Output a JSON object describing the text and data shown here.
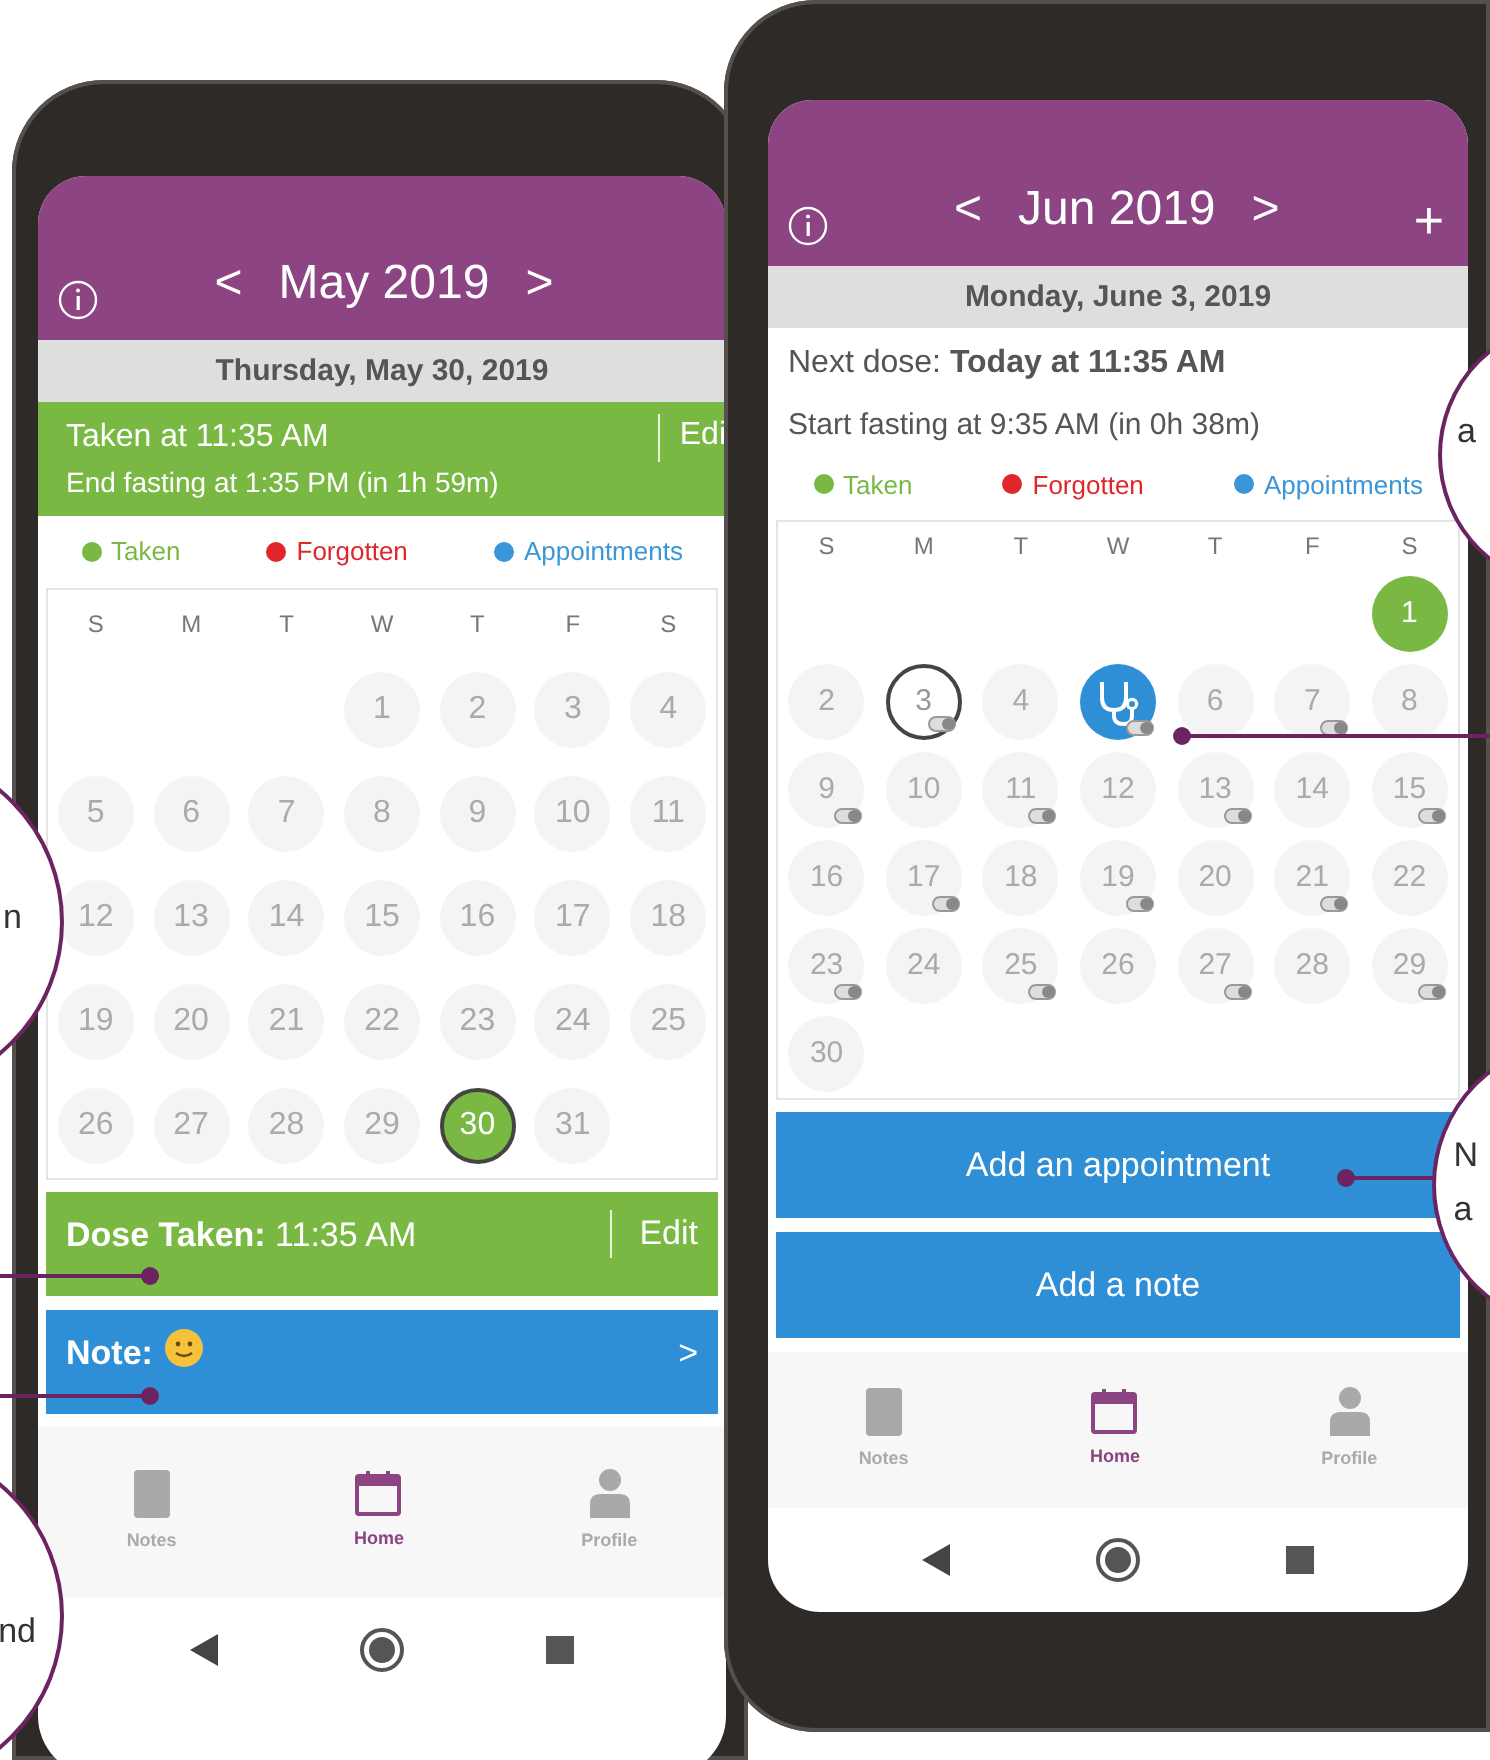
{
  "phones": [
    {
      "header": {
        "prev": "<",
        "title": "May 2019",
        "next": ">"
      },
      "date": "Thursday, May 30, 2019",
      "status": {
        "kind": "taken",
        "line1": "Taken at 11:35 AM",
        "edit": "Edi",
        "line2": "End fasting at 1:35 PM (in 1h 59m)"
      },
      "legend": [
        {
          "label": "Taken",
          "color": "#78b843"
        },
        {
          "label": "Forgotten",
          "color": "#e0262b"
        },
        {
          "label": "Appointments",
          "color": "#3a96d6"
        }
      ],
      "weekdays": [
        "S",
        "M",
        "T",
        "W",
        "T",
        "F",
        "S"
      ],
      "weeks": [
        [
          {
            "kind": "blank"
          },
          {
            "kind": "blank"
          },
          {
            "kind": "blank"
          },
          {
            "kind": "day",
            "day": "1",
            "taken": false,
            "selected": false,
            "pill": false
          },
          {
            "kind": "day",
            "day": "2",
            "taken": false,
            "selected": false,
            "pill": false
          },
          {
            "kind": "day",
            "day": "3",
            "taken": false,
            "selected": false,
            "pill": false
          },
          {
            "kind": "day",
            "day": "4",
            "taken": false,
            "selected": false,
            "pill": false
          }
        ],
        [
          {
            "kind": "day",
            "day": "5",
            "taken": false,
            "selected": false,
            "pill": false
          },
          {
            "kind": "day",
            "day": "6",
            "taken": false,
            "selected": false,
            "pill": false
          },
          {
            "kind": "day",
            "day": "7",
            "taken": false,
            "selected": false,
            "pill": false
          },
          {
            "kind": "day",
            "day": "8",
            "taken": false,
            "selected": false,
            "pill": false
          },
          {
            "kind": "day",
            "day": "9",
            "taken": false,
            "selected": false,
            "pill": false
          },
          {
            "kind": "day",
            "day": "10",
            "taken": false,
            "selected": false,
            "pill": false
          },
          {
            "kind": "day",
            "day": "11",
            "taken": false,
            "selected": false,
            "pill": false
          }
        ],
        [
          {
            "kind": "day",
            "day": "12",
            "taken": false,
            "selected": false,
            "pill": false
          },
          {
            "kind": "day",
            "day": "13",
            "taken": false,
            "selected": false,
            "pill": false
          },
          {
            "kind": "day",
            "day": "14",
            "taken": false,
            "selected": false,
            "pill": false
          },
          {
            "kind": "day",
            "day": "15",
            "taken": false,
            "selected": false,
            "pill": false
          },
          {
            "kind": "day",
            "day": "16",
            "taken": false,
            "selected": false,
            "pill": false
          },
          {
            "kind": "day",
            "day": "17",
            "taken": false,
            "selected": false,
            "pill": false
          },
          {
            "kind": "day",
            "day": "18",
            "taken": false,
            "selected": false,
            "pill": false
          }
        ],
        [
          {
            "kind": "day",
            "day": "19",
            "taken": false,
            "selected": false,
            "pill": false
          },
          {
            "kind": "day",
            "day": "20",
            "taken": false,
            "selected": false,
            "pill": false
          },
          {
            "kind": "day",
            "day": "21",
            "taken": false,
            "selected": false,
            "pill": false
          },
          {
            "kind": "day",
            "day": "22",
            "taken": false,
            "selected": false,
            "pill": false
          },
          {
            "kind": "day",
            "day": "23",
            "taken": false,
            "selected": false,
            "pill": false
          },
          {
            "kind": "day",
            "day": "24",
            "taken": false,
            "selected": false,
            "pill": false
          },
          {
            "kind": "day",
            "day": "25",
            "taken": false,
            "selected": false,
            "pill": false
          }
        ],
        [
          {
            "kind": "day",
            "day": "26",
            "taken": false,
            "selected": false,
            "pill": false
          },
          {
            "kind": "day",
            "day": "27",
            "taken": false,
            "selected": false,
            "pill": false
          },
          {
            "kind": "day",
            "day": "28",
            "taken": false,
            "selected": false,
            "pill": false
          },
          {
            "kind": "day",
            "day": "29",
            "taken": false,
            "selected": false,
            "pill": false
          },
          {
            "kind": "day",
            "day": "30",
            "taken": true,
            "selected": true,
            "pill": false
          },
          {
            "kind": "day",
            "day": "31",
            "taken": false,
            "selected": false,
            "pill": false
          },
          {
            "kind": "blank"
          }
        ]
      ],
      "actions": [
        {
          "kind": "dose",
          "label": "Dose Taken:",
          "text": "11:35 AM",
          "edit": "Edit"
        },
        {
          "kind": "note",
          "label": "Note:",
          "arrow": ">"
        }
      ],
      "tabs": [
        {
          "kind": "notes",
          "label": "Notes",
          "selected": false
        },
        {
          "kind": "home",
          "label": "Home",
          "selected": true
        },
        {
          "kind": "profile",
          "label": "Profile",
          "selected": false
        }
      ]
    },
    {
      "header": {
        "prev": "<",
        "title": "Jun 2019",
        "next": ">",
        "add": "+"
      },
      "date": "Monday, June 3, 2019",
      "status": {
        "kind": "next",
        "line1": "Next dose: **Today at 11:35 AM**",
        "line2": "Start fasting at 9:35 AM (in 0h 38m)"
      },
      "legend": [
        {
          "label": "Taken",
          "color": "#78b843"
        },
        {
          "label": "Forgotten",
          "color": "#e0262b"
        },
        {
          "label": "Appointments",
          "color": "#3a96d6"
        }
      ],
      "weekdays": [
        "S",
        "M",
        "T",
        "W",
        "T",
        "F",
        "S"
      ],
      "weeks": [
        [
          {
            "kind": "blank"
          },
          {
            "kind": "blank"
          },
          {
            "kind": "blank"
          },
          {
            "kind": "blank"
          },
          {
            "kind": "blank"
          },
          {
            "kind": "blank"
          },
          {
            "kind": "day",
            "day": "1",
            "taken": true,
            "selected": false,
            "pill": false
          }
        ],
        [
          {
            "kind": "day",
            "day": "2",
            "taken": false,
            "selected": false,
            "pill": false
          },
          {
            "kind": "day",
            "day": "3",
            "taken": false,
            "selected": true,
            "pill": true
          },
          {
            "kind": "day",
            "day": "4",
            "taken": false,
            "selected": false,
            "pill": false
          },
          {
            "kind": "appointment",
            "taken": false,
            "selected": false,
            "pill": true
          },
          {
            "kind": "day",
            "day": "6",
            "taken": false,
            "selected": false,
            "pill": false
          },
          {
            "kind": "day",
            "day": "7",
            "taken": false,
            "selected": false,
            "pill": true
          },
          {
            "kind": "day",
            "day": "8",
            "taken": false,
            "selected": false,
            "pill": false
          }
        ],
        [
          {
            "kind": "day",
            "day": "9",
            "taken": false,
            "selected": false,
            "pill": true
          },
          {
            "kind": "day",
            "day": "10",
            "taken": false,
            "selected": false,
            "pill": false
          },
          {
            "kind": "day",
            "day": "11",
            "taken": false,
            "selected": false,
            "pill": true
          },
          {
            "kind": "day",
            "day": "12",
            "taken": false,
            "selected": false,
            "pill": false
          },
          {
            "kind": "day",
            "day": "13",
            "taken": false,
            "selected": false,
            "pill": true
          },
          {
            "kind": "day",
            "day": "14",
            "taken": false,
            "selected": false,
            "pill": false
          },
          {
            "kind": "day",
            "day": "15",
            "taken": false,
            "selected": false,
            "pill": true
          }
        ],
        [
          {
            "kind": "day",
            "day": "16",
            "taken": false,
            "selected": false,
            "pill": false
          },
          {
            "kind": "day",
            "day": "17",
            "taken": false,
            "selected": false,
            "pill": true
          },
          {
            "kind": "day",
            "day": "18",
            "taken": false,
            "selected": false,
            "pill": false
          },
          {
            "kind": "day",
            "day": "19",
            "taken": false,
            "selected": false,
            "pill": true
          },
          {
            "kind": "day",
            "day": "20",
            "taken": false,
            "selected": false,
            "pill": false
          },
          {
            "kind": "day",
            "day": "21",
            "taken": false,
            "selected": false,
            "pill": true
          },
          {
            "kind": "day",
            "day": "22",
            "taken": false,
            "selected": false,
            "pill": false
          }
        ],
        [
          {
            "kind": "day",
            "day": "23",
            "taken": false,
            "selected": false,
            "pill": true
          },
          {
            "kind": "day",
            "day": "24",
            "taken": false,
            "selected": false,
            "pill": false
          },
          {
            "kind": "day",
            "day": "25",
            "taken": false,
            "selected": false,
            "pill": true
          },
          {
            "kind": "day",
            "day": "26",
            "taken": false,
            "selected": false,
            "pill": false
          },
          {
            "kind": "day",
            "day": "27",
            "taken": false,
            "selected": false,
            "pill": true
          },
          {
            "kind": "day",
            "day": "28",
            "taken": false,
            "selected": false,
            "pill": false
          },
          {
            "kind": "day",
            "day": "29",
            "taken": false,
            "selected": false,
            "pill": true
          }
        ],
        [
          {
            "kind": "day",
            "day": "30",
            "taken": false,
            "selected": false,
            "pill": false
          },
          {
            "kind": "blank"
          },
          {
            "kind": "blank"
          },
          {
            "kind": "blank"
          },
          {
            "kind": "blank"
          },
          {
            "kind": "blank"
          },
          {
            "kind": "blank"
          }
        ]
      ],
      "actions": [
        {
          "kind": "button",
          "text": "Add an appointment"
        },
        {
          "kind": "button",
          "text": "Add a note"
        }
      ],
      "tabs": [
        {
          "kind": "notes",
          "label": "Notes",
          "selected": false
        },
        {
          "kind": "home",
          "label": "Home",
          "selected": true
        },
        {
          "kind": "profile",
          "label": "Profile",
          "selected": false
        }
      ]
    }
  ],
  "callouts": [
    {
      "lines": [
        "n"
      ]
    },
    {
      "lines": [
        "nd"
      ]
    },
    {
      "lines": [
        "a"
      ]
    },
    {
      "lines": [
        "N",
        "a"
      ]
    }
  ]
}
